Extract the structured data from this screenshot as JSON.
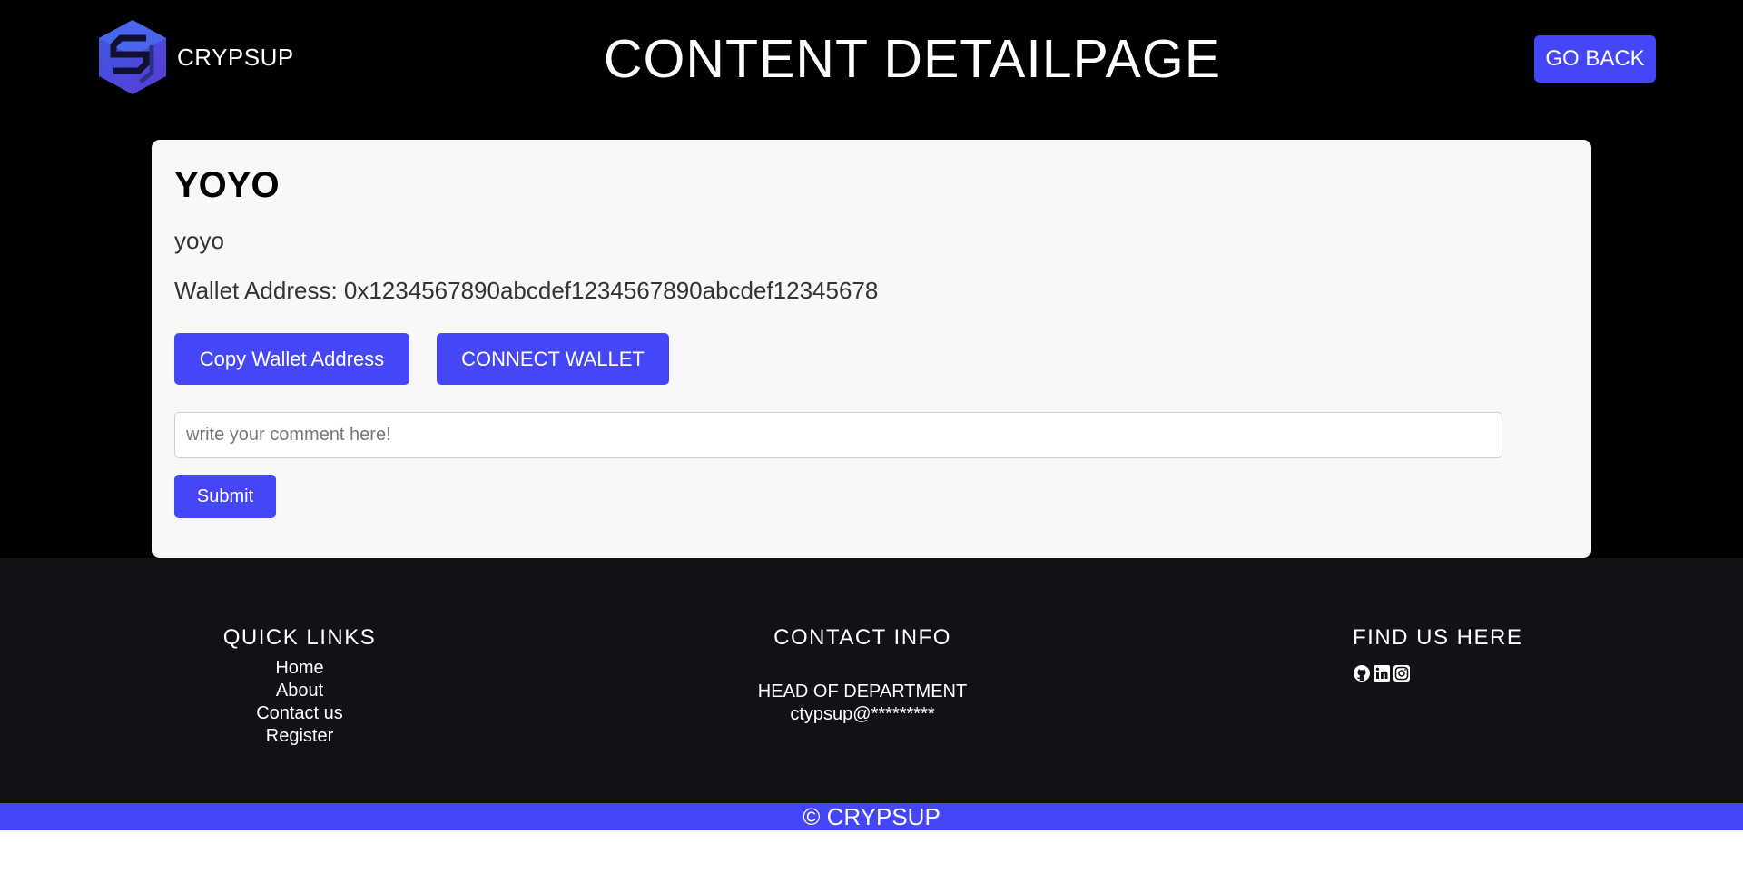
{
  "header": {
    "brand": "CRYPSUP",
    "logo_icon": "crypsup-logo-icon",
    "title": "CONTENT DETAILPAGE",
    "go_back_label": "GO BACK"
  },
  "content": {
    "title": "YOYO",
    "description": "yoyo",
    "wallet_line": "Wallet Address: 0x1234567890abcdef1234567890abcdef12345678",
    "copy_wallet_label": "Copy Wallet Address",
    "connect_wallet_label": "CONNECT WALLET",
    "comment_placeholder": "write your comment here!",
    "comment_value": "",
    "submit_label": "Submit"
  },
  "footer": {
    "quick_links": {
      "heading": "QUICK LINKS",
      "items": [
        "Home",
        "About",
        "Contact us",
        "Register"
      ]
    },
    "contact_info": {
      "heading": "CONTACT INFO",
      "role": "HEAD OF DEPARTMENT",
      "email": "ctypsup@*********"
    },
    "find_us": {
      "heading": "FIND US HERE",
      "icons": [
        "github-icon",
        "linkedin-icon",
        "instagram-icon"
      ]
    },
    "copyright": "© CRYPSUP"
  },
  "colors": {
    "accent": "#4646f9",
    "header_bg": "#000000",
    "card_bg": "#f8f8f8",
    "footer_bg": "#111116"
  }
}
